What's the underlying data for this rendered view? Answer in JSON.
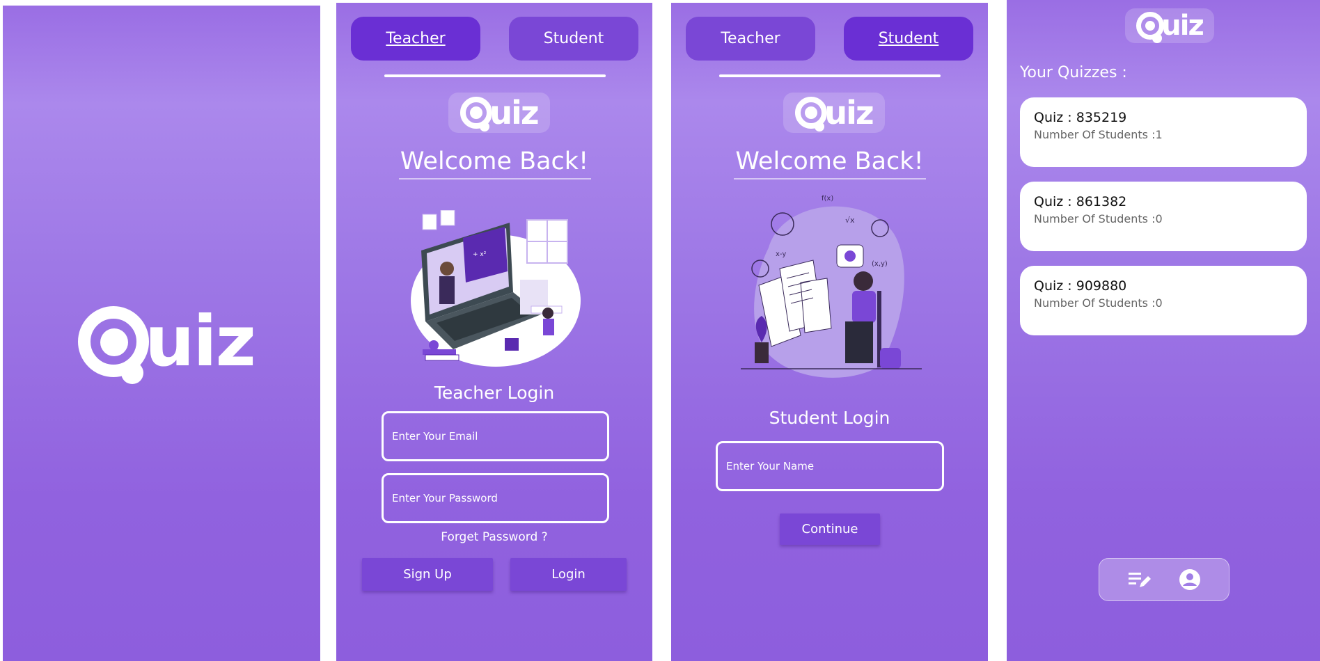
{
  "splash": {
    "logo_text": "uiz"
  },
  "teacher_screen": {
    "tabs": [
      {
        "label": "Teacher",
        "active": true
      },
      {
        "label": "Student",
        "active": false
      }
    ],
    "logo_text": "uiz",
    "welcome": "Welcome Back!",
    "login_title": "Teacher Login",
    "email_placeholder": "Enter Your Email",
    "password_placeholder": "Enter Your Password",
    "forget_password": "Forget Password ?",
    "signup_label": "Sign Up",
    "login_label": "Login"
  },
  "student_screen": {
    "tabs": [
      {
        "label": "Teacher",
        "active": false
      },
      {
        "label": "Student",
        "active": true
      }
    ],
    "logo_text": "uiz",
    "welcome": "Welcome Back!",
    "login_title": "Student Login",
    "name_placeholder": "Enter Your Name",
    "continue_label": "Continue"
  },
  "quizzes_screen": {
    "logo_text": "uiz",
    "title": "Your Quizzes :",
    "quizzes": [
      {
        "title": "Quiz : 835219",
        "students": "Number Of Students :1"
      },
      {
        "title": "Quiz : 861382",
        "students": "Number Of Students :0"
      },
      {
        "title": "Quiz : 909880",
        "students": "Number Of Students :0"
      }
    ],
    "nav": [
      {
        "icon": "edit-list-icon"
      },
      {
        "icon": "account-circle-icon"
      }
    ]
  },
  "colors": {
    "background_top": "#9a6ee4",
    "background_bottom": "#8d5edd",
    "tab": "#7a47d6",
    "tab_active": "#6a2fd4",
    "button": "#7a47d6",
    "card": "#ffffff"
  }
}
